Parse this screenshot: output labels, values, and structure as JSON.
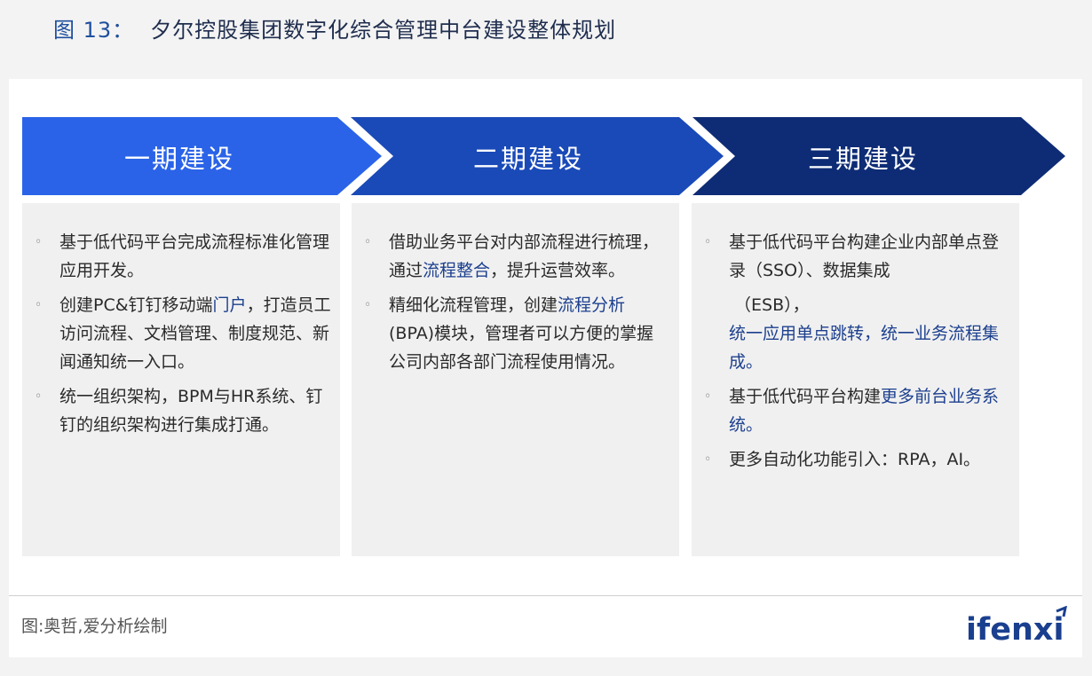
{
  "figure": {
    "number": "图 13：",
    "title": "夕尔控股集团数字化综合管理中台建设整体规划"
  },
  "colors": {
    "phase1": "#2a63e8",
    "phase2": "#1a4ab8",
    "phase3": "#0e2c75",
    "highlight": "#1c3f8e"
  },
  "phases": [
    {
      "label": "一期建设",
      "items": [
        {
          "parts": [
            {
              "t": "基于低代码平台完成流程标准化管理应用开发。"
            }
          ]
        },
        {
          "parts": [
            {
              "t": "创建PC&钉钉移动端"
            },
            {
              "t": "门户",
              "hl": true
            },
            {
              "t": "，打造员工访问流程、文档管理、制度规范、新闻通知统一入口。"
            }
          ]
        },
        {
          "parts": [
            {
              "t": "统一组织架构，BPM与HR系统、钉钉的组织架构进行集成打通。"
            }
          ]
        }
      ]
    },
    {
      "label": "二期建设",
      "items": [
        {
          "parts": [
            {
              "t": "借助业务平台对内部流程进行梳理，通过"
            },
            {
              "t": "流程整合",
              "hl": true
            },
            {
              "t": "，提升运营效率。"
            }
          ]
        },
        {
          "parts": [
            {
              "t": "精细化流程管理，创建"
            },
            {
              "t": "流程分析",
              "hl": true
            },
            {
              "t": "(BPA)模块，管理者可以方便的掌握公司内部各部门流程使用情况。"
            }
          ]
        }
      ]
    },
    {
      "label": "三期建设",
      "items": [
        {
          "parts": [
            {
              "t": "基于低代码平台构建企业内部单点登录（SSO）、数据集成"
            },
            {
              "t": "（ESB），",
              "br": true
            },
            {
              "t": "统一应用单点跳转，统一业务流程集成。",
              "hl": true
            }
          ]
        },
        {
          "parts": [
            {
              "t": "基于低代码平台构建"
            },
            {
              "t": "更多前台业务系统。",
              "hl": true
            }
          ]
        },
        {
          "parts": [
            {
              "t": "更多自动化功能引入：RPA，AI。"
            }
          ]
        }
      ]
    }
  ],
  "bullet_glyph": "◦",
  "source": "图:奥哲,爱分析绘制",
  "logo": {
    "text": "ifenxi"
  }
}
